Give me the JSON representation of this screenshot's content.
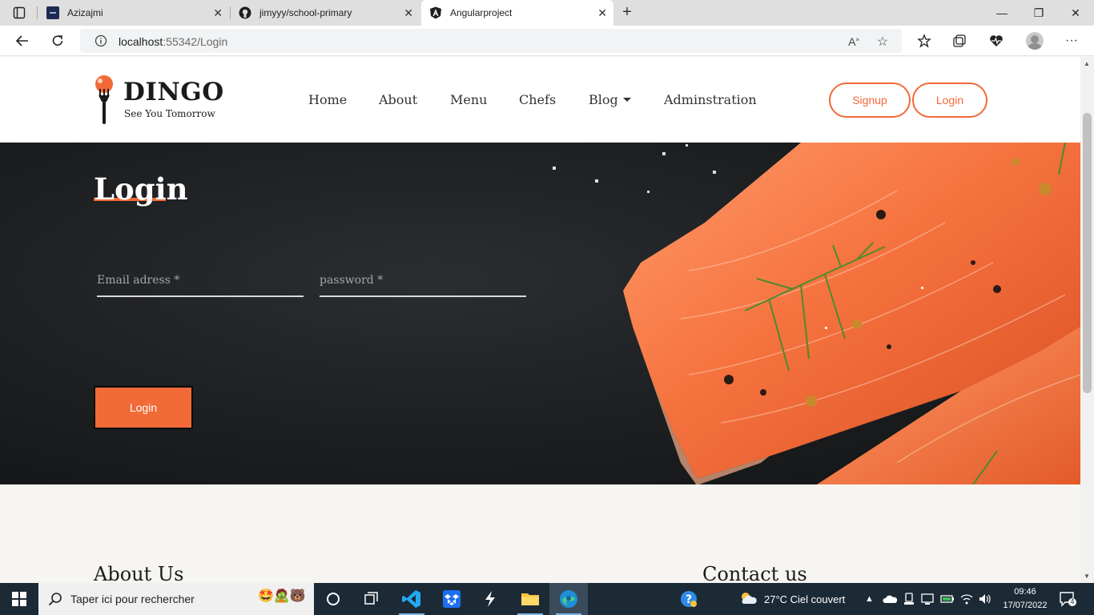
{
  "browser": {
    "tabs": [
      {
        "title": "Azizajmi"
      },
      {
        "title": "jimyyy/school-primary"
      },
      {
        "title": "Angularproject",
        "active": true
      }
    ],
    "url_host": "localhost",
    "url_rest": ":55342/Login"
  },
  "site": {
    "logo": {
      "word": "DINGO",
      "tagline": "See You Tomorrow"
    },
    "nav": [
      "Home",
      "About",
      "Menu",
      "Chefs",
      "Blog",
      "Adminstration"
    ],
    "signup_label": "Signup",
    "login_pill_label": "Login",
    "hero": {
      "title": "Login",
      "email_placeholder": "Email adress *",
      "password_placeholder": "password *",
      "submit_label": "Login"
    },
    "sections": {
      "about": "About Us",
      "contact": "Contact us"
    }
  },
  "taskbar": {
    "search_placeholder": "Taper ici pour rechercher",
    "weather": "27°C  Ciel couvert",
    "time": "09:46",
    "date": "17/07/2022",
    "notifications": "4"
  },
  "colors": {
    "accent": "#f26a37",
    "taskbar": "#1c2a36"
  }
}
